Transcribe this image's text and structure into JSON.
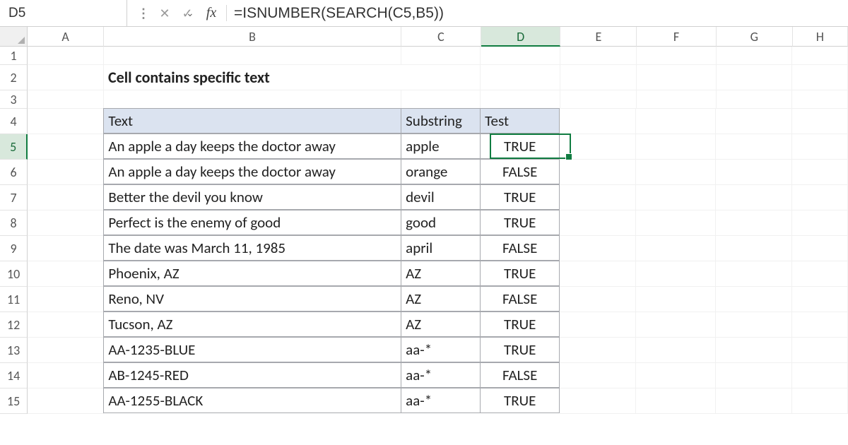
{
  "formula_bar": {
    "cell_ref": "D5",
    "formula": "=ISNUMBER(SEARCH(C5,B5))"
  },
  "columns": [
    "A",
    "B",
    "C",
    "D",
    "E",
    "F",
    "G",
    "H"
  ],
  "active_col": "D",
  "active_row": 5,
  "title": "Cell contains specific text",
  "table": {
    "headers": {
      "text": "Text",
      "substring": "Substring",
      "test": "Test"
    },
    "rows": [
      {
        "text": "An apple a day keeps the doctor away",
        "substring": "apple",
        "test": "TRUE"
      },
      {
        "text": "An apple a day keeps the doctor away",
        "substring": "orange",
        "test": "FALSE"
      },
      {
        "text": "Better the devil you know",
        "substring": "devil",
        "test": "TRUE"
      },
      {
        "text": "Perfect is the enemy of good",
        "substring": "good",
        "test": "TRUE"
      },
      {
        "text": "The date was March 11, 1985",
        "substring": "april",
        "test": "FALSE"
      },
      {
        "text": "Phoenix, AZ",
        "substring": "AZ",
        "test": "TRUE"
      },
      {
        "text": "Reno, NV",
        "substring": "AZ",
        "test": "FALSE"
      },
      {
        "text": "Tucson, AZ",
        "substring": "AZ",
        "test": "TRUE"
      },
      {
        "text": "AA-1235-BLUE",
        "substring": "aa-*",
        "test": "TRUE"
      },
      {
        "text": "AB-1245-RED",
        "substring": "aa-*",
        "test": "FALSE"
      },
      {
        "text": "AA-1255-BLACK",
        "substring": "aa-*",
        "test": "TRUE"
      }
    ]
  },
  "chart_data": {
    "type": "table",
    "title": "Cell contains specific text",
    "columns": [
      "Text",
      "Substring",
      "Test"
    ],
    "rows": [
      [
        "An apple a day keeps the doctor away",
        "apple",
        "TRUE"
      ],
      [
        "An apple a day keeps the doctor away",
        "orange",
        "FALSE"
      ],
      [
        "Better the devil you know",
        "devil",
        "TRUE"
      ],
      [
        "Perfect is the enemy of good",
        "good",
        "TRUE"
      ],
      [
        "The date was March 11, 1985",
        "april",
        "FALSE"
      ],
      [
        "Phoenix, AZ",
        "AZ",
        "TRUE"
      ],
      [
        "Reno, NV",
        "AZ",
        "FALSE"
      ],
      [
        "Tucson, AZ",
        "AZ",
        "TRUE"
      ],
      [
        "AA-1235-BLUE",
        "aa-*",
        "TRUE"
      ],
      [
        "AB-1245-RED",
        "aa-*",
        "FALSE"
      ],
      [
        "AA-1255-BLACK",
        "aa-*",
        "TRUE"
      ]
    ]
  }
}
